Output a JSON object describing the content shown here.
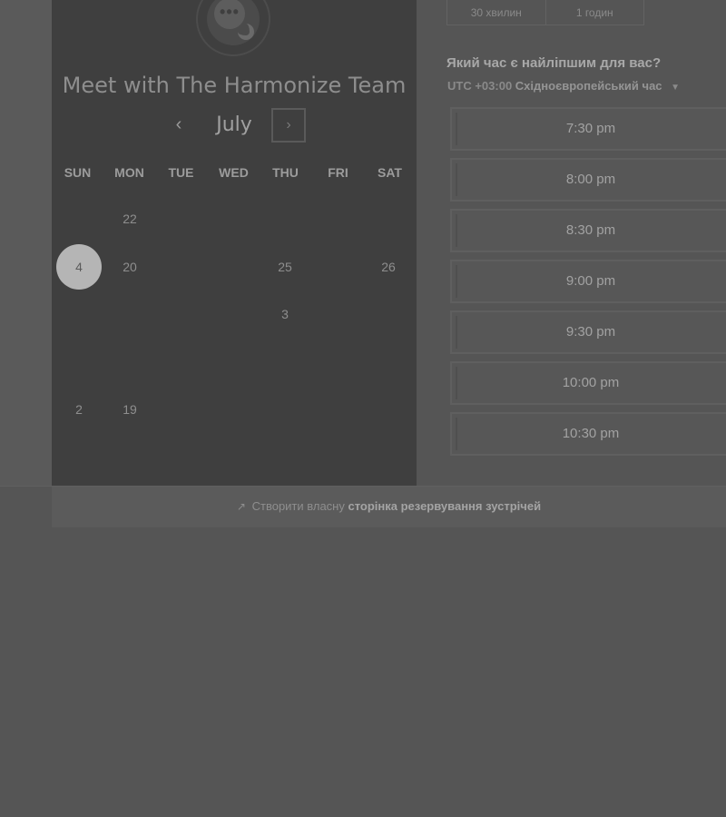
{
  "calendar": {
    "title": "Meet with The Harmonize Team",
    "avatar_glyph": "•••",
    "month": "July",
    "prev_icon": "‹",
    "next_icon": "›",
    "weekdays": [
      "SUN",
      "MON",
      "TUE",
      "WED",
      "THU",
      "FRI",
      "SAT"
    ],
    "days": {
      "d22": "22",
      "d4": "4",
      "d20": "20",
      "d25": "25",
      "d26": "26",
      "d3": "3",
      "d2": "2",
      "d19": "19"
    },
    "selected_day": "4"
  },
  "booking": {
    "durations": [
      "30 хвилин",
      "1 годин"
    ],
    "question": "Який час є найліпшим для вас?",
    "timezone_offset": "UTC +03:00",
    "timezone_name": "Східноєвропейський час",
    "timezone_caret": "▼",
    "slots": [
      "7:30 pm",
      "8:00 pm",
      "8:30 pm",
      "9:00 pm",
      "9:30 pm",
      "10:00 pm",
      "10:30 pm"
    ]
  },
  "footer": {
    "icon": "↗",
    "text": "Створити власну",
    "link": "сторінка резервування зустрічей"
  }
}
